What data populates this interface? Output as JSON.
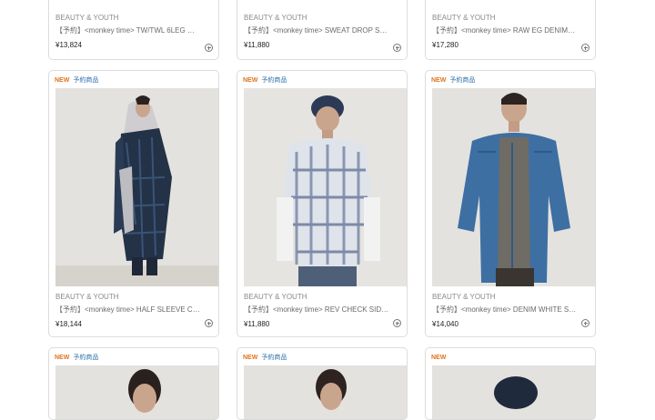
{
  "products": {
    "top": [
      {
        "brand": "BEAUTY & YOUTH",
        "title": "【予約】<monkey time> TW/TWL 6LEG …",
        "price": "¥13,824"
      },
      {
        "brand": "BEAUTY & YOUTH",
        "title": "【予約】<monkey time> SWEAT DROP S…",
        "price": "¥11,880"
      },
      {
        "brand": "BEAUTY & YOUTH",
        "title": "【予約】<monkey time> RAW EG DENIM…",
        "price": "¥17,280"
      }
    ],
    "middle": [
      {
        "badge_new": "NEW",
        "badge_pre": "予約商品",
        "brand": "BEAUTY & YOUTH",
        "title": "【予約】<monkey time> HALF SLEEVE C…",
        "price": "¥18,144",
        "image": "model in hoodie and plaid coat"
      },
      {
        "badge_new": "NEW",
        "badge_pre": "予約商品",
        "brand": "BEAUTY & YOUTH",
        "title": "【予約】<monkey time> REV CHECK SID…",
        "price": "¥11,880",
        "image": "model in beanie and check shirt"
      },
      {
        "badge_new": "NEW",
        "badge_pre": "予約商品",
        "brand": "BEAUTY & YOUTH",
        "title": "【予約】<monkey time> DENIM WHITE S…",
        "price": "¥14,040",
        "image": "model in denim shirt"
      }
    ],
    "bottom": [
      {
        "badge_new": "NEW",
        "badge_pre": "予約商品"
      },
      {
        "badge_new": "NEW",
        "badge_pre": "予約商品"
      },
      {
        "badge_new": "NEW",
        "badge_pre": ""
      }
    ]
  },
  "icons": {
    "add": "plus-circle-icon"
  },
  "colors": {
    "new_badge": "#e0731c",
    "preorder_badge": "#2d6fa8",
    "photo_bg": "#e3e1dc"
  }
}
